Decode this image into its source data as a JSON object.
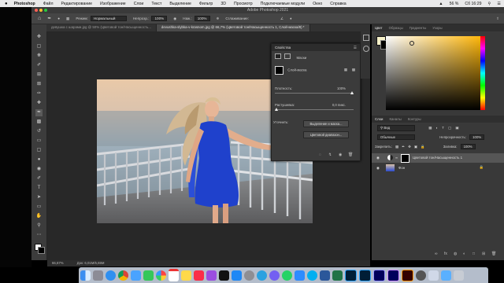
{
  "menubar": {
    "apple": "",
    "items": [
      "Photoshop",
      "Файл",
      "Редактирование",
      "Изображение",
      "Слои",
      "Текст",
      "Выделение",
      "Фильтр",
      "3D",
      "Просмотр",
      "Подключаемые модули",
      "Окно",
      "Справка"
    ],
    "battery": "56 %",
    "time": "Сб 16:29"
  },
  "window": {
    "title": "Adobe Photoshop 2021"
  },
  "options": {
    "mode_label": "Режим:",
    "mode_value": "Нормальный",
    "opacity_label": "Непрозр.:",
    "opacity_value": "100%",
    "flow_label": "Наж.:",
    "flow_value": "100%",
    "smoothing_label": "Сглаживание:"
  },
  "tabs": [
    {
      "label": "девушка с шарами.jpg @ 50% (Цветовой тон/Насыщенность...",
      "active": false
    },
    {
      "label": "devushka-slybka-v-krasnom.jpg @ 66,7% (Цветовой тон/Насыщенность 1, Слой-маска/8) *",
      "active": true
    }
  ],
  "properties": {
    "title": "Свойства",
    "subtitle": "Маски",
    "mask_label": "Слой-маска",
    "density_label": "Плотность:",
    "density_value": "100%",
    "feather_label": "Растушевка:",
    "feather_value": "0,0 пикс.",
    "refine_label": "Уточнить:",
    "select_mask_button": "Выделение и маска...",
    "color_range_button": "Цветовой диапазон...",
    "invert_button": "Инвертировать"
  },
  "color_panel": {
    "tabs": [
      "Цвет",
      "Образцы",
      "Градиенты",
      "Узоры"
    ],
    "active_tab": "Цвет",
    "swatch_color": "#f5f0c8"
  },
  "layers_panel": {
    "tabs": [
      "Слои",
      "Каналы",
      "Контуры"
    ],
    "active_tab": "Слои",
    "filter_label": "Вид",
    "blend_mode": "Обычные",
    "opacity_label": "Непрозрачность:",
    "opacity_value": "100%",
    "lock_label": "Закрепить:",
    "fill_label": "Заливка:",
    "fill_value": "100%",
    "layers": [
      {
        "name": "Цветовой тон/Насыщенность 1",
        "selected": true
      },
      {
        "name": "Фон",
        "selected": false
      }
    ]
  },
  "status": {
    "zoom": "66,67%",
    "doc": "Док: 6,01M/6,65M"
  },
  "colors": {
    "dress": "#1d3fc9",
    "accent": "#2f66d6"
  }
}
